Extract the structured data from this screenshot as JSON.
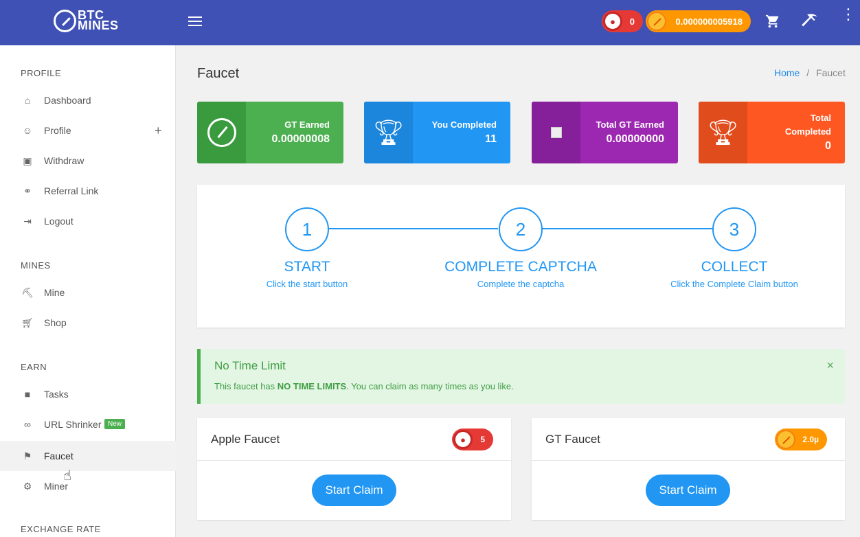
{
  "header": {
    "logo_top": "BTC",
    "logo_bottom": "MINES",
    "apple_balance": "0",
    "gt_balance": "0.000000005918",
    "icons": [
      "menu-icon",
      "cart-icon",
      "pickaxe-icon",
      "more-vert-icon"
    ]
  },
  "sidebar": {
    "profile_title": "PROFILE",
    "profile_items": [
      {
        "label": "Dashboard",
        "icon": "home-icon"
      },
      {
        "label": "Profile",
        "icon": "user-icon"
      },
      {
        "label": "Withdraw",
        "icon": "wallet-icon"
      },
      {
        "label": "Referral Link",
        "icon": "handshake-icon"
      },
      {
        "label": "Logout",
        "icon": "logout-icon"
      }
    ],
    "profile_plus": "+",
    "mines_title": "MINES",
    "mines_items": [
      {
        "label": "Mine",
        "icon": "pickaxe-icon"
      },
      {
        "label": "Shop",
        "icon": "cart-icon"
      }
    ],
    "earn_title": "EARN",
    "earn_items": [
      {
        "label": "Tasks",
        "icon": "briefcase-icon"
      },
      {
        "label": "URL Shrinker",
        "icon": "link-icon",
        "badge": "New"
      },
      {
        "label": "Faucet",
        "icon": "faucet-icon",
        "active": true
      },
      {
        "label": "Miner",
        "icon": "gears-icon"
      }
    ],
    "exchange_title": "EXCHANGE RATE"
  },
  "page": {
    "title": "Faucet",
    "breadcrumb_home": "Home",
    "breadcrumb_sep": "/",
    "breadcrumb_current": "Faucet"
  },
  "stats": [
    {
      "label": "GT Earned",
      "value": "0.00000008",
      "color": "#4caf50"
    },
    {
      "label": "You Completed",
      "value": "11",
      "color": "#2196f3"
    },
    {
      "label": "Total GT Earned",
      "value": "0.00000000",
      "color": "#9c27b0"
    },
    {
      "label_line1": "Total",
      "label_line2": "Completed",
      "value": "0",
      "color": "#ff5722"
    }
  ],
  "steps": [
    {
      "num": "1",
      "title": "START",
      "sub": "Click the start button"
    },
    {
      "num": "2",
      "title": "COMPLETE CAPTCHA",
      "sub": "Complete the captcha"
    },
    {
      "num": "3",
      "title": "COLLECT",
      "sub": "Click the Complete Claim button"
    }
  ],
  "alert": {
    "title": "No Time Limit",
    "body_pre": "This faucet has ",
    "body_bold": "NO TIME LIMITS",
    "body_post": ". You can claim as many times as you like.",
    "close": "×"
  },
  "faucets": [
    {
      "title": "Apple Faucet",
      "reward": "5",
      "button": "Start Claim"
    },
    {
      "title": "GT Faucet",
      "reward": "2.0µ",
      "button": "Start Claim"
    }
  ]
}
